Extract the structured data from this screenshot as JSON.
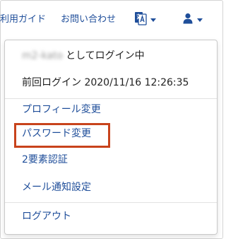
{
  "header": {
    "guide_link": "利用ガイド",
    "contact_link": "お問い合わせ",
    "language_icon": "language-translate-icon",
    "user_icon": "user-icon",
    "accent_color": "#1f4e9a"
  },
  "user_menu": {
    "username": "m2-kato",
    "logged_in_suffix": "としてログイン中",
    "last_login": "前回ログイン 2020/11/16 12:26:35",
    "items": [
      {
        "label": "プロフィール変更"
      },
      {
        "label": "パスワード変更",
        "highlighted": true
      },
      {
        "label": "2要素認証"
      },
      {
        "label": "メール通知設定"
      }
    ],
    "logout": "ログアウト",
    "highlight_color": "#c8431c"
  }
}
